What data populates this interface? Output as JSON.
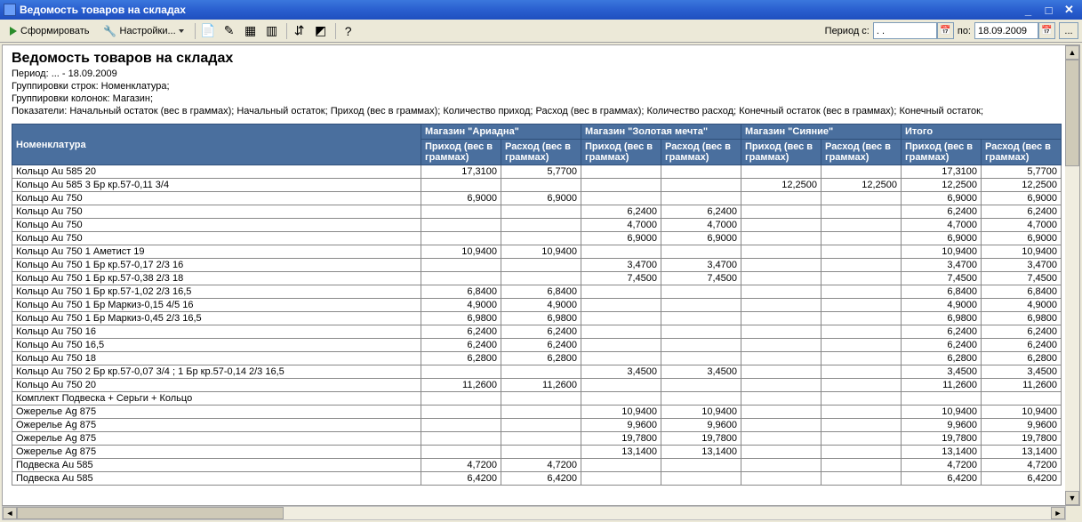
{
  "window": {
    "title": "Ведомость товаров на складах"
  },
  "toolbar": {
    "generate": "Сформировать",
    "settings": "Настройки...",
    "period_from_label": "Период с:",
    "period_from": ". .",
    "period_to_label": "по:",
    "period_to": "18.09.2009"
  },
  "report": {
    "title": "Ведомость товаров на складах",
    "meta": [
      "Период: ... - 18.09.2009",
      "Группировки строк: Номенклатура;",
      "Группировки колонок: Магазин;",
      "Показатели: Начальный остаток (вес в граммах); Начальный остаток; Приход (вес в граммах); Количество приход; Расход (вес в граммах); Количество расход; Конечный остаток (вес в граммах); Конечный остаток;"
    ]
  },
  "columns": {
    "nomenclature": "Номенклатура",
    "groups": [
      "Магазин \"Ариадна\"",
      "Магазин \"Золотая мечта\"",
      "Магазин \"Сияние\"",
      "Итого"
    ],
    "sub_in": "Приход (вес в граммах)",
    "sub_out": "Расход (вес в граммах)"
  },
  "rows": [
    {
      "name": "Кольцо Au 585 20",
      "v": [
        "17,3100",
        "5,7700",
        "",
        "",
        "",
        "",
        "17,3100",
        "5,7700"
      ]
    },
    {
      "name": "Кольцо Au 585 3 Бр кр.57-0,11 3/4",
      "v": [
        "",
        "",
        "",
        "",
        "12,2500",
        "12,2500",
        "12,2500",
        "12,2500"
      ]
    },
    {
      "name": "Кольцо Au 750",
      "v": [
        "6,9000",
        "6,9000",
        "",
        "",
        "",
        "",
        "6,9000",
        "6,9000"
      ]
    },
    {
      "name": "Кольцо Au 750",
      "v": [
        "",
        "",
        "6,2400",
        "6,2400",
        "",
        "",
        "6,2400",
        "6,2400"
      ]
    },
    {
      "name": "Кольцо Au 750",
      "v": [
        "",
        "",
        "4,7000",
        "4,7000",
        "",
        "",
        "4,7000",
        "4,7000"
      ]
    },
    {
      "name": "Кольцо Au 750",
      "v": [
        "",
        "",
        "6,9000",
        "6,9000",
        "",
        "",
        "6,9000",
        "6,9000"
      ]
    },
    {
      "name": "Кольцо Au 750 1 Аметист 19",
      "v": [
        "10,9400",
        "10,9400",
        "",
        "",
        "",
        "",
        "10,9400",
        "10,9400"
      ]
    },
    {
      "name": "Кольцо Au 750 1 Бр кр.57-0,17 2/3 16",
      "v": [
        "",
        "",
        "3,4700",
        "3,4700",
        "",
        "",
        "3,4700",
        "3,4700"
      ]
    },
    {
      "name": "Кольцо Au 750 1 Бр кр.57-0,38 2/3 18",
      "v": [
        "",
        "",
        "7,4500",
        "7,4500",
        "",
        "",
        "7,4500",
        "7,4500"
      ]
    },
    {
      "name": "Кольцо Au 750 1 Бр кр.57-1,02 2/3 16,5",
      "v": [
        "6,8400",
        "6,8400",
        "",
        "",
        "",
        "",
        "6,8400",
        "6,8400"
      ]
    },
    {
      "name": "Кольцо Au 750 1 Бр Маркиз-0,15 4/5 16",
      "v": [
        "4,9000",
        "4,9000",
        "",
        "",
        "",
        "",
        "4,9000",
        "4,9000"
      ]
    },
    {
      "name": "Кольцо Au 750 1 Бр Маркиз-0,45 2/3 16,5",
      "v": [
        "6,9800",
        "6,9800",
        "",
        "",
        "",
        "",
        "6,9800",
        "6,9800"
      ]
    },
    {
      "name": "Кольцо Au 750 16",
      "v": [
        "6,2400",
        "6,2400",
        "",
        "",
        "",
        "",
        "6,2400",
        "6,2400"
      ]
    },
    {
      "name": "Кольцо Au 750 16,5",
      "v": [
        "6,2400",
        "6,2400",
        "",
        "",
        "",
        "",
        "6,2400",
        "6,2400"
      ]
    },
    {
      "name": "Кольцо Au 750 18",
      "v": [
        "6,2800",
        "6,2800",
        "",
        "",
        "",
        "",
        "6,2800",
        "6,2800"
      ]
    },
    {
      "name": "Кольцо Au 750 2 Бр кр.57-0,07 3/4 ; 1 Бр кр.57-0,14 2/3 16,5",
      "v": [
        "",
        "",
        "3,4500",
        "3,4500",
        "",
        "",
        "3,4500",
        "3,4500"
      ]
    },
    {
      "name": "Кольцо Au 750 20",
      "v": [
        "11,2600",
        "11,2600",
        "",
        "",
        "",
        "",
        "11,2600",
        "11,2600"
      ]
    },
    {
      "name": "Комплект Подвеска + Серьги + Кольцо",
      "v": [
        "",
        "",
        "",
        "",
        "",
        "",
        "",
        ""
      ]
    },
    {
      "name": "Ожерелье Ag 875",
      "v": [
        "",
        "",
        "10,9400",
        "10,9400",
        "",
        "",
        "10,9400",
        "10,9400"
      ]
    },
    {
      "name": "Ожерелье Ag 875",
      "v": [
        "",
        "",
        "9,9600",
        "9,9600",
        "",
        "",
        "9,9600",
        "9,9600"
      ]
    },
    {
      "name": "Ожерелье Ag 875",
      "v": [
        "",
        "",
        "19,7800",
        "19,7800",
        "",
        "",
        "19,7800",
        "19,7800"
      ]
    },
    {
      "name": "Ожерелье Ag 875",
      "v": [
        "",
        "",
        "13,1400",
        "13,1400",
        "",
        "",
        "13,1400",
        "13,1400"
      ]
    },
    {
      "name": "Подвеска Au 585",
      "v": [
        "4,7200",
        "4,7200",
        "",
        "",
        "",
        "",
        "4,7200",
        "4,7200"
      ]
    },
    {
      "name": "Подвеска Au 585",
      "v": [
        "6,4200",
        "6,4200",
        "",
        "",
        "",
        "",
        "6,4200",
        "6,4200"
      ]
    }
  ]
}
